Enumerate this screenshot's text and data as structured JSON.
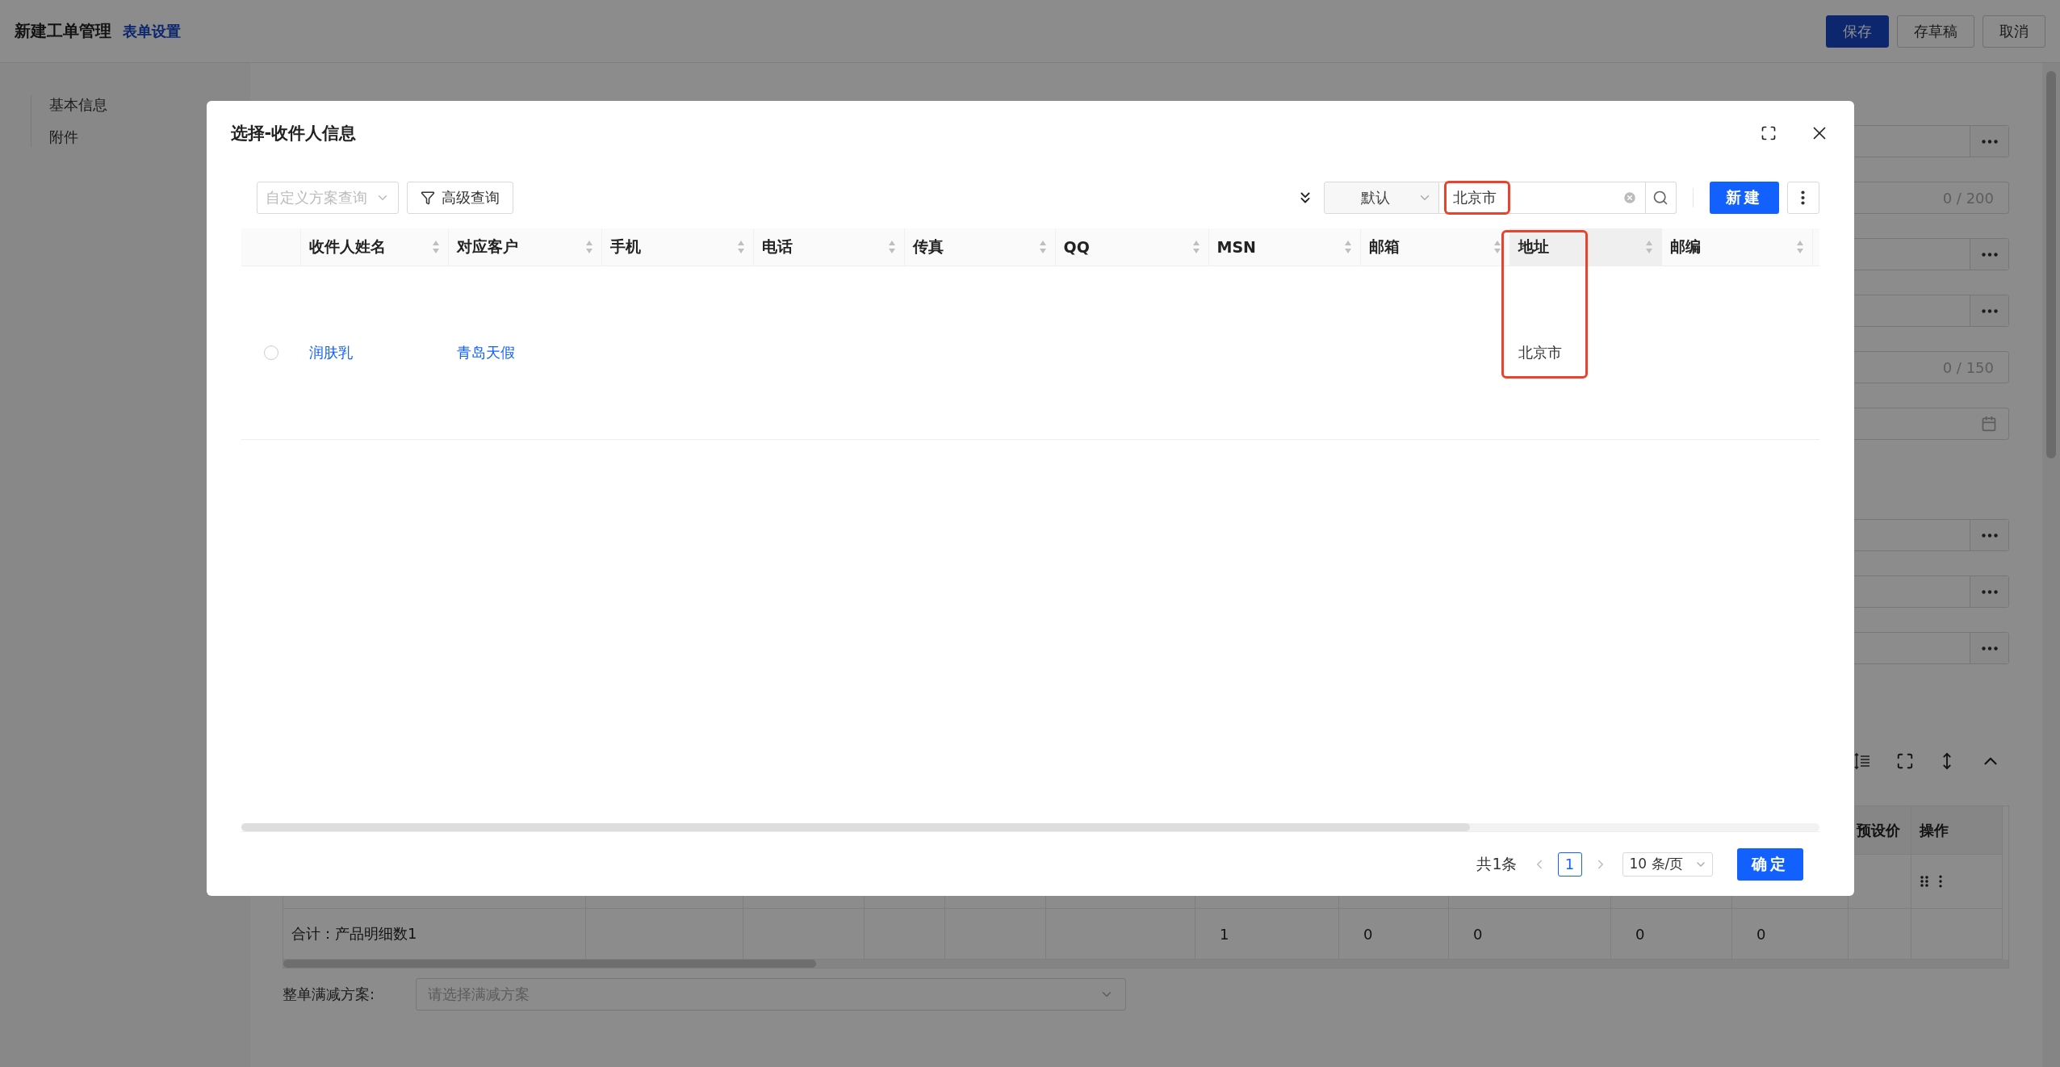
{
  "header": {
    "title": "新建工单管理",
    "link": "表单设置",
    "buttons": [
      {
        "label": "保存",
        "kind": "primary"
      },
      {
        "label": "存草稿",
        "kind": "default"
      },
      {
        "label": "取消",
        "kind": "default"
      }
    ]
  },
  "sidebar": {
    "items": [
      {
        "label": "基本信息"
      },
      {
        "label": "附件"
      }
    ]
  },
  "form": {
    "fields": [
      {
        "kind": "picker"
      },
      {
        "kind": "counter",
        "count": "0 / 200"
      },
      {
        "kind": "picker"
      },
      {
        "kind": "picker"
      },
      {
        "kind": "counter",
        "count": "0 / 150"
      },
      {
        "kind": "date"
      },
      {
        "kind": "picker"
      },
      {
        "kind": "picker"
      },
      {
        "kind": "picker"
      }
    ]
  },
  "detail_table": {
    "columns": [
      "预设价",
      "操作"
    ],
    "summary": {
      "label": "合计：产品明细数1",
      "values": [
        "1",
        "0",
        "0",
        "0",
        "0"
      ]
    }
  },
  "discount": {
    "label": "整单满减方案:",
    "placeholder": "请选择满减方案"
  },
  "dialog": {
    "title": "选择-收件人信息",
    "scheme_select": {
      "placeholder": "自定义方案查询"
    },
    "advanced_button": "高级查询",
    "mode_select": {
      "value": "默认"
    },
    "search": {
      "value": "北京市",
      "highlighted": true
    },
    "new_button": "新建",
    "columns": [
      {
        "label": "收件人姓名",
        "sorted": false,
        "highlighted": false
      },
      {
        "label": "对应客户",
        "sorted": false,
        "highlighted": false
      },
      {
        "label": "手机",
        "sorted": false,
        "highlighted": false
      },
      {
        "label": "电话",
        "sorted": false,
        "highlighted": false
      },
      {
        "label": "传真",
        "sorted": false,
        "highlighted": false
      },
      {
        "label": "QQ",
        "sorted": false,
        "highlighted": false
      },
      {
        "label": "MSN",
        "sorted": false,
        "highlighted": false
      },
      {
        "label": "邮箱",
        "sorted": false,
        "highlighted": false
      },
      {
        "label": "地址",
        "sorted": true,
        "highlighted": true
      },
      {
        "label": "邮编",
        "sorted": false,
        "highlighted": false
      }
    ],
    "rows": [
      {
        "selected": false,
        "name": "润肤乳",
        "customer": "青岛天假",
        "address": "北京市"
      }
    ],
    "pagination": {
      "total": "共1条",
      "pages": [
        {
          "label": "1",
          "selected": true
        }
      ],
      "page_size": "10 条/页"
    },
    "confirm_button": "确定"
  }
}
